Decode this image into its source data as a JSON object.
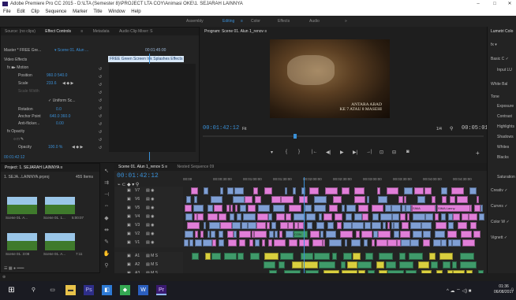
{
  "titlebar": {
    "title": "Adobe Premiere Pro CC 2015 - D:\\LTA (Semester 8)\\PROJECT LTA COY\\Animasi OKE\\1. SEJARAH LAINNYA",
    "minimize": "–",
    "maximize": "□",
    "close": "✕"
  },
  "menubar": [
    "File",
    "Edit",
    "Clip",
    "Sequence",
    "Marker",
    "Title",
    "Window",
    "Help"
  ],
  "workspaces": [
    "Assembly",
    "Editing",
    "≡",
    "Color",
    "Effects",
    "Audio",
    "»"
  ],
  "effect_controls": {
    "tabs": [
      "Source: (no clips)",
      "Effect Controls",
      "≡",
      "Metadata",
      "Audio Clip Mixer: S"
    ],
    "master": "Master * FREE Gre...",
    "clip": "▾ Scene 01. Alun ...",
    "timecode": "00:01:45:00",
    "tooltip": "FREE Green Screen Ink Splashes Effects",
    "video_effects": "Video Effects",
    "motion": "fx ■▸ Motion",
    "position_label": "Position",
    "position_values": "960.0   540.0",
    "scale_label": "Scale",
    "scale_value": "233.6",
    "scale_width_label": "Scale Width",
    "uniform": "✓ Uniform Sc...",
    "rotation_label": "Rotation",
    "rotation_value": "0.0",
    "anchor_label": "Anchor Point",
    "anchor_values": "640.0   360.0",
    "antiflicker_label": "Anti-flicker...",
    "antiflicker_value": "0.00",
    "opacity_section": "fx Opacity",
    "opacity_label": "Opacity",
    "opacity_value": "100.0 %",
    "bottom_tc": "00:01:42:12"
  },
  "program": {
    "title": "Program: Scene 01. Alun 1_renov ≡",
    "timecode": "00:01:42:12",
    "fit": "Fit",
    "ratio": "1/4",
    "duration": "00:05:01:07",
    "overlay_line1": "ANTARA ABAD",
    "overlay_line2": "KE 7 ATAU 8 MASEHI",
    "controls": [
      "▾",
      "{",
      "}",
      "|←",
      "◀|",
      "◀",
      "▶",
      "▶|",
      "→|",
      "⊡",
      "⊟",
      "◙",
      "+"
    ]
  },
  "lumetri": {
    "title": "Lumetri Colo",
    "items": [
      "Basic C ✓",
      "Input LU",
      "White Bal",
      "Tone",
      "Exposure",
      "Contrast",
      "Highlights",
      "Shadows",
      "Whites",
      "Blacks",
      "Saturation",
      "Creativ ✓",
      "Curves ✓",
      "Color W ✓",
      "Vignett ✓"
    ]
  },
  "project": {
    "title": "Project: 1. SEJARAH LAINNYA ≡",
    "file": "1. SEJA...LAINNYA.prproj",
    "count": "455 Items",
    "items": [
      {
        "name": "Scene 01. A...",
        "dur": "9:09"
      },
      {
        "name": "Scene 01. 1...",
        "dur": "5:00:07"
      },
      {
        "name": "Scene 01. 3:08",
        "dur": ""
      },
      {
        "name": "Scene 01. A...",
        "dur": "7:11"
      }
    ]
  },
  "timeline": {
    "tabs": [
      "Scene 01. Alun 1_renov S ≡",
      "Nested Sequence 09"
    ],
    "timecode": "00:01:42:12",
    "ruler": [
      "00:00",
      "00:00:30:00",
      "00:01:00:00",
      "00:01:30:00",
      "00:02:00:00",
      "00:02:30:00",
      "00:03:00:00",
      "00:03:30:00",
      "00:04:00:00",
      "00:04:30:00"
    ],
    "tracks": [
      "V7",
      "V6",
      "V5",
      "V4",
      "V3",
      "V2",
      "V1",
      "A1",
      "A2",
      "A3"
    ],
    "clip_labels": [
      "SIMA",
      "SIMA Lanny",
      "CON"
    ]
  },
  "taskbar": {
    "time": "01:36",
    "date": "06/08/2017"
  },
  "colors": {
    "accent": "#3a8fd6",
    "clip_pink": "#e17ed8",
    "clip_blue": "#7f9fd4",
    "clip_green": "#3f9a6a",
    "clip_yellow": "#d9cf3e"
  }
}
